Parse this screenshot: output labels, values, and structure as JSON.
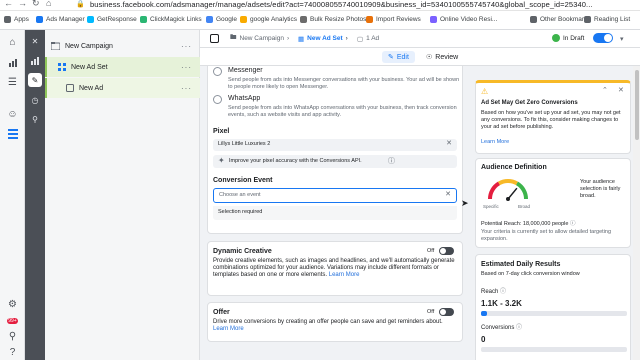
{
  "browser": {
    "url": "business.facebook.com/adsmanager/manage/adsets/edit?act=740008055740010909&business_id=5340100555745740&global_scope_id=25340...",
    "bookmarks": [
      {
        "label": "Apps",
        "color": "#5f6368"
      },
      {
        "label": "Ads Manager",
        "color": "#1877f2"
      },
      {
        "label": "GetResponse",
        "color": "#00baff"
      },
      {
        "label": "ClickMagick Links",
        "color": "#2bb673"
      },
      {
        "label": "Google",
        "color": "#4285f4"
      },
      {
        "label": "google Analytics",
        "color": "#f9ab00"
      },
      {
        "label": "Bulk Resize Photos",
        "color": "#6c6c6c"
      },
      {
        "label": "Import Reviews",
        "color": "#e8710a"
      },
      {
        "label": "Online Video Resi...",
        "color": "#7b61ff"
      },
      {
        "label": "Other Bookmarks",
        "color": "#5f6368"
      },
      {
        "label": "Reading List",
        "color": "#5f6368"
      }
    ]
  },
  "rail": {
    "icons": [
      "home-icon",
      "chart-icon",
      "menu-icon",
      "emoji-icon",
      "grid-icon",
      "settings-icon",
      "notification-icon",
      "search-icon",
      "help-icon"
    ],
    "notification_badge": "99+"
  },
  "tree": {
    "items": [
      {
        "label": "New Campaign",
        "dots": "···"
      },
      {
        "label": "New Ad Set",
        "dots": "···"
      },
      {
        "label": "New Ad",
        "dots": "···"
      }
    ]
  },
  "header": {
    "campaign": "New Campaign",
    "adset": "New Ad Set",
    "ad": "1 Ad",
    "status": "In Draft"
  },
  "tabs": {
    "edit": "Edit",
    "review": "Review"
  },
  "form": {
    "messenger_title": "Messenger",
    "messenger_desc": "Send people from ads into Messenger conversations with your business. Your ad will be shown to people more likely to open Messenger.",
    "whatsapp_title": "WhatsApp",
    "whatsapp_desc": "Send people from ads into WhatsApp conversations with your business, then track conversion events, such as website visits and app activity.",
    "pixel_label": "Pixel",
    "pixel_value": "Lillys Little Luxuries 2",
    "pixel_tip": "Improve your pixel accuracy with the Conversions API.",
    "conversion_label": "Conversion Event",
    "conversion_placeholder": "Choose an event",
    "conversion_error": "Selection required",
    "dynamic_title": "Dynamic Creative",
    "dynamic_state": "Off",
    "dynamic_desc": "Provide creative elements, such as images and headlines, and we'll automatically generate combinations optimized for your audience. Variations may include different formats or templates based on one or more elements.",
    "dynamic_link": "Learn More",
    "offer_title": "Offer",
    "offer_state": "Off",
    "offer_desc": "Drive more conversions by creating an offer people can save and get reminders about.",
    "offer_link": "Learn More"
  },
  "side": {
    "warning_title": "Ad Set May Get Zero Conversions",
    "warning_desc": "Based on how you've set up your ad set, you may not get any conversions. To fix this, consider making changes to your ad set before publishing.",
    "warning_link": "Learn More",
    "audience_title": "Audience Definition",
    "audience_note": "Your audience selection is fairly broad.",
    "gauge_specific": "Specific",
    "gauge_broad": "Broad",
    "gauge_level": 0.72,
    "reach_text": "Potential Reach: 18,000,000 people",
    "reach_note": "Your criteria is currently set to allow detailed targeting expansion.",
    "daily_title": "Estimated Daily Results",
    "daily_sub": "Based on 7-day click conversion window",
    "reach_label": "Reach",
    "reach_value": "1.1K - 3.2K",
    "conv_label": "Conversions",
    "conv_value": "0"
  },
  "colors": {
    "accent": "#1877f2",
    "tree_selected": "#e6f2d9",
    "tree_border": "#8fc65a",
    "warning": "#f7b928"
  }
}
